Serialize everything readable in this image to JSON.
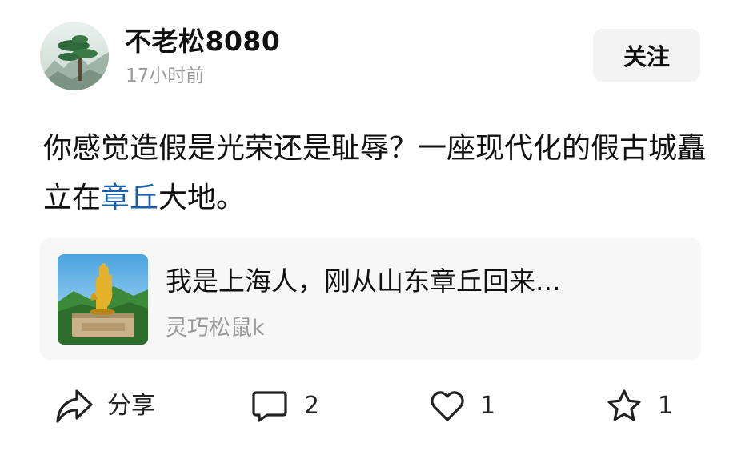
{
  "author": {
    "name": "不老松8080",
    "time": "17小时前",
    "follow_label": "关注"
  },
  "post": {
    "text_before": "你感觉造假是光荣还是耻辱？一座现代化的假古城矗立在",
    "topic_link": "章丘",
    "text_after": "大地。"
  },
  "quoted": {
    "title": "我是上海人，刚从山东章丘回来...",
    "author": "灵巧松鼠k"
  },
  "actions": {
    "share_label": "分享",
    "comment_count": "2",
    "like_count": "1",
    "favorite_count": "1"
  },
  "icons": {
    "share": "share-arrow-icon",
    "comment": "comment-bubble-icon",
    "like": "heart-icon",
    "favorite": "star-icon"
  },
  "colors": {
    "link": "#1a5fa8",
    "muted": "#9a9a9a",
    "card_bg": "#f7f7f7",
    "button_bg": "#f3f3f3"
  }
}
